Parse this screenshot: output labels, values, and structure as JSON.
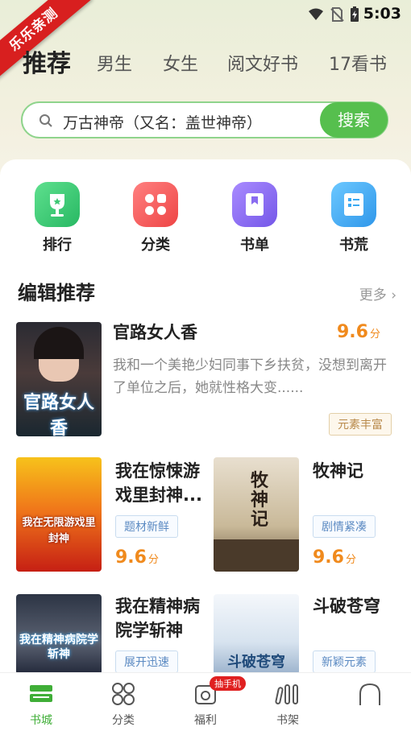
{
  "status": {
    "time": "5:03"
  },
  "ribbon": "乐乐亲测",
  "tabs": [
    "推荐",
    "男生",
    "女生",
    "阅文好书",
    "17看书"
  ],
  "search": {
    "query": "万古神帝（又名：盖世神帝）",
    "button": "搜索"
  },
  "categories": [
    {
      "label": "排行",
      "icon": "trophy-icon",
      "color": "#3dc873"
    },
    {
      "label": "分类",
      "icon": "grid-icon",
      "color": "#f25a5a"
    },
    {
      "label": "书单",
      "icon": "booklist-icon",
      "color": "#8a6cf0"
    },
    {
      "label": "书荒",
      "icon": "book-icon",
      "color": "#3aa9f2"
    }
  ],
  "section": {
    "title": "编辑推荐",
    "more": "更多"
  },
  "featured": {
    "title": "官路女人香",
    "score": "9.6",
    "unit": "分",
    "desc": "我和一个美艳少妇同事下乡扶贫，没想到离开了单位之后，她就性格大变......",
    "tag": "元素丰富",
    "cover_text": "官路女人香"
  },
  "books": [
    {
      "title_l1": "我在惊悚游",
      "title_l2": "戏里封神...",
      "tag": "题材新鲜",
      "score": "9.6",
      "unit": "分",
      "cover_text": "我在无限游戏里封神"
    },
    {
      "title_l1": "牧神记",
      "title_l2": "",
      "tag": "剧情紧凑",
      "score": "9.6",
      "unit": "分",
      "cover_text": "牧神记"
    },
    {
      "title_l1": "我在精神病",
      "title_l2": "院学斩神",
      "tag": "展开迅速",
      "cover_text": "我在精神病院学斩神"
    },
    {
      "title_l1": "斗破苍穹",
      "title_l2": "",
      "tag": "新颖元素",
      "cover_text": "斗破苍穹"
    }
  ],
  "nav": [
    {
      "label": "书城",
      "icon": "bookstore-icon",
      "active": true
    },
    {
      "label": "分类",
      "icon": "category-icon",
      "active": false
    },
    {
      "label": "福利",
      "icon": "gift-icon",
      "active": false,
      "badge": "抽手机"
    },
    {
      "label": "书架",
      "icon": "bookshelf-icon",
      "active": false
    },
    {
      "label": "",
      "icon": "profile-icon",
      "active": false
    }
  ],
  "colors": {
    "accent": "#56bf4e",
    "score": "#f08a1d"
  }
}
